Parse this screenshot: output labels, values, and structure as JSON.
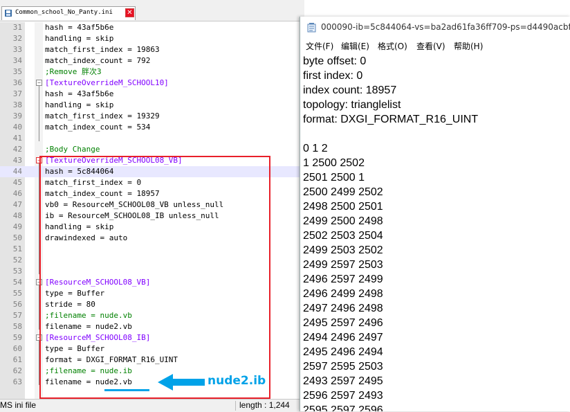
{
  "editor": {
    "tab_title": "Common_school_No_Panty.ini",
    "close_glyph": "✕",
    "lines": [
      {
        "n": "31",
        "text": "hash = 43af5b6e",
        "kind": "normal"
      },
      {
        "n": "32",
        "text": "handling = skip",
        "kind": "normal"
      },
      {
        "n": "33",
        "text": "match_first_index = 19863",
        "kind": "normal"
      },
      {
        "n": "34",
        "text": "match_index_count = 792",
        "kind": "normal"
      },
      {
        "n": "35",
        "text": ";Remove 胖次3",
        "kind": "comment"
      },
      {
        "n": "36",
        "text": "[TextureOverrideM_SCHOOL10]",
        "kind": "section"
      },
      {
        "n": "37",
        "text": "hash = 43af5b6e",
        "kind": "normal"
      },
      {
        "n": "38",
        "text": "handling = skip",
        "kind": "normal"
      },
      {
        "n": "39",
        "text": "match_first_index = 19329",
        "kind": "normal"
      },
      {
        "n": "40",
        "text": "match_index_count = 534",
        "kind": "normal"
      },
      {
        "n": "41",
        "text": "",
        "kind": "normal"
      },
      {
        "n": "42",
        "text": ";Body Change",
        "kind": "comment"
      },
      {
        "n": "43",
        "text": "[TextureOverrideM_SCHOOL08_VB]",
        "kind": "section"
      },
      {
        "n": "44",
        "text": "hash = 5c844064",
        "kind": "normal"
      },
      {
        "n": "45",
        "text": "match_first_index = 0",
        "kind": "normal"
      },
      {
        "n": "46",
        "text": "match_index_count = 18957",
        "kind": "normal"
      },
      {
        "n": "47",
        "text": "vb0 = ResourceM_SCHOOL08_VB unless_null",
        "kind": "normal"
      },
      {
        "n": "48",
        "text": "ib = ResourceM_SCHOOL08_IB unless_null",
        "kind": "normal"
      },
      {
        "n": "49",
        "text": "handling = skip",
        "kind": "normal"
      },
      {
        "n": "50",
        "text": "drawindexed = auto",
        "kind": "normal"
      },
      {
        "n": "51",
        "text": "",
        "kind": "normal"
      },
      {
        "n": "52",
        "text": "",
        "kind": "normal"
      },
      {
        "n": "53",
        "text": "",
        "kind": "normal"
      },
      {
        "n": "54",
        "text": "[ResourceM_SCHOOL08_VB]",
        "kind": "section"
      },
      {
        "n": "55",
        "text": "type = Buffer",
        "kind": "normal"
      },
      {
        "n": "56",
        "text": "stride = 80",
        "kind": "normal"
      },
      {
        "n": "57",
        "text": ";filename = nude.vb",
        "kind": "comment"
      },
      {
        "n": "58",
        "text": "filename = nude2.vb",
        "kind": "normal"
      },
      {
        "n": "59",
        "text": "[ResourceM_SCHOOL08_IB]",
        "kind": "section"
      },
      {
        "n": "60",
        "text": "type = Buffer",
        "kind": "normal"
      },
      {
        "n": "61",
        "text": "format = DXGI_FORMAT_R16_UINT",
        "kind": "normal"
      },
      {
        "n": "62",
        "text": ";filename = nude.ib",
        "kind": "comment"
      },
      {
        "n": "63",
        "text": "filename = nude2.vb",
        "kind": "normal"
      }
    ],
    "status_file_type": "MS ini file",
    "status_length": "length : 1,244"
  },
  "annotation": {
    "label": "nude2.ib",
    "color": "#00a2e8",
    "box_color": "#e8202a"
  },
  "notepad": {
    "title": "000090-ib=5c844064-vs=ba2ad61fa36ff709-ps=d4490acbf65b",
    "menu": [
      "文件(F)",
      "编辑(E)",
      "格式(O)",
      "查看(V)",
      "帮助(H)"
    ],
    "content_lines": [
      "byte offset: 0",
      "first index: 0",
      "index count: 18957",
      "topology: trianglelist",
      "format: DXGI_FORMAT_R16_UINT",
      "",
      "0 1 2",
      "1 2500 2502",
      "2501 2500 1",
      "2500 2499 2502",
      "2498 2500 2501",
      "2499 2500 2498",
      "2502 2503 2504",
      "2499 2503 2502",
      "2499 2597 2503",
      "2496 2597 2499",
      "2496 2499 2498",
      "2497 2496 2498",
      "2495 2597 2496",
      "2494 2496 2497",
      "2495 2496 2494",
      "2597 2595 2503",
      "2493 2597 2495",
      "2596 2597 2493",
      "2595 2597 2596"
    ]
  },
  "icons": {
    "tab_icon": "ini-file-icon",
    "notepad_icon": "notepad-icon",
    "arrow": "arrow-left-icon"
  }
}
